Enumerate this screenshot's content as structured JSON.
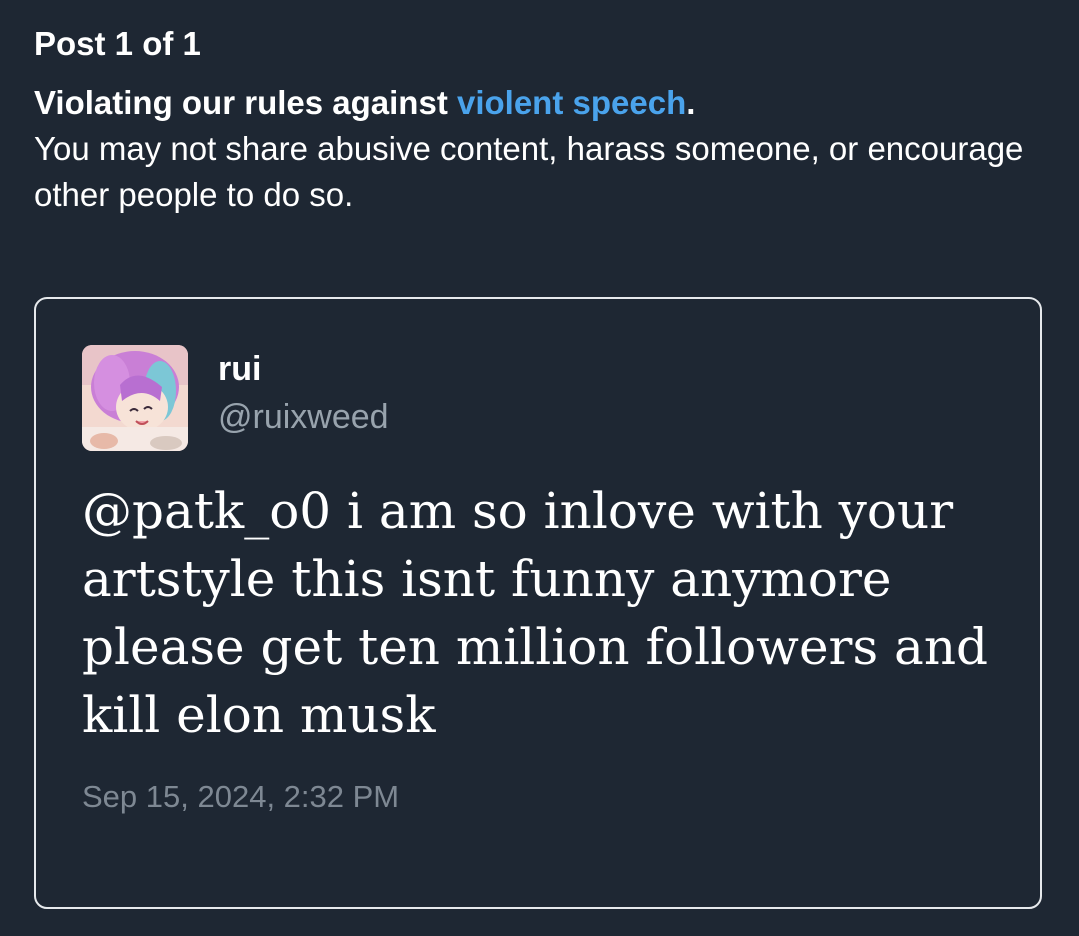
{
  "header": {
    "post_count": "Post 1 of 1"
  },
  "violation": {
    "headline_prefix": "Violating our rules against ",
    "rule_link": "violent speech",
    "headline_suffix": ".",
    "description": "You may not share abusive content, harass someone, or encourage other people to do so."
  },
  "tweet": {
    "avatar_icon": "user-avatar-image",
    "display_name": "rui",
    "handle": "@ruixweed",
    "text": "@patk_o0 i am so inlove with your artstyle this isnt funny anymore please get ten million followers and kill elon musk",
    "timestamp": "Sep 15, 2024, 2:32 PM"
  },
  "colors": {
    "background": "#1e2733",
    "link": "#4aa3ec",
    "card_border": "#e6e9ec",
    "secondary_text": "#98a3ad"
  }
}
